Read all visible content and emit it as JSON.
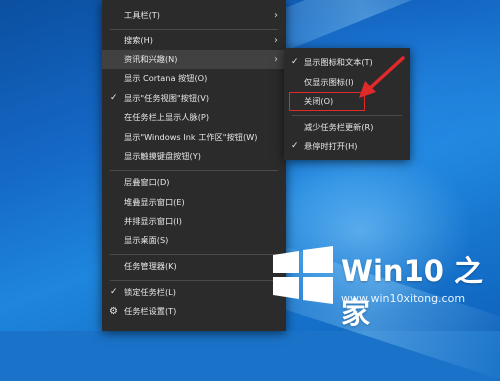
{
  "context_menu": {
    "items": [
      {
        "label": "工具栏(T)",
        "submenu": true
      },
      {
        "label": "搜索(H)",
        "submenu": true
      },
      {
        "label": "资讯和兴趣(N)",
        "submenu": true
      },
      {
        "label": "显示 Cortana 按钮(O)"
      },
      {
        "label": "显示\"任务视图\"按钮(V)",
        "checked": true
      },
      {
        "label": "在任务栏上显示人脉(P)"
      },
      {
        "label": "显示\"Windows Ink 工作区\"按钮(W)"
      },
      {
        "label": "显示触摸键盘按钮(Y)"
      },
      {
        "label": "层叠窗口(D)"
      },
      {
        "label": "堆叠显示窗口(E)"
      },
      {
        "label": "并排显示窗口(I)"
      },
      {
        "label": "显示桌面(S)"
      },
      {
        "label": "任务管理器(K)"
      },
      {
        "label": "锁定任务栏(L)",
        "checked": true
      },
      {
        "label": "任务栏设置(T)",
        "icon": "gear-icon"
      }
    ]
  },
  "submenu": {
    "items": [
      {
        "label": "显示图标和文本(T)",
        "checked": true
      },
      {
        "label": "仅显示图标(I)"
      },
      {
        "label": "关闭(O)",
        "highlighted": true
      },
      {
        "label": "减少任务栏更新(R)"
      },
      {
        "label": "悬停时打开(H)",
        "checked": true
      }
    ]
  },
  "watermark": {
    "title": "Win10 之家",
    "url": "www.win10xitong.com"
  },
  "colors": {
    "menu_bg": "#2b2b2b",
    "menu_text": "#e8e8e8",
    "highlight_box": "#e02a2a",
    "desktop_blue": "#1569c7"
  }
}
